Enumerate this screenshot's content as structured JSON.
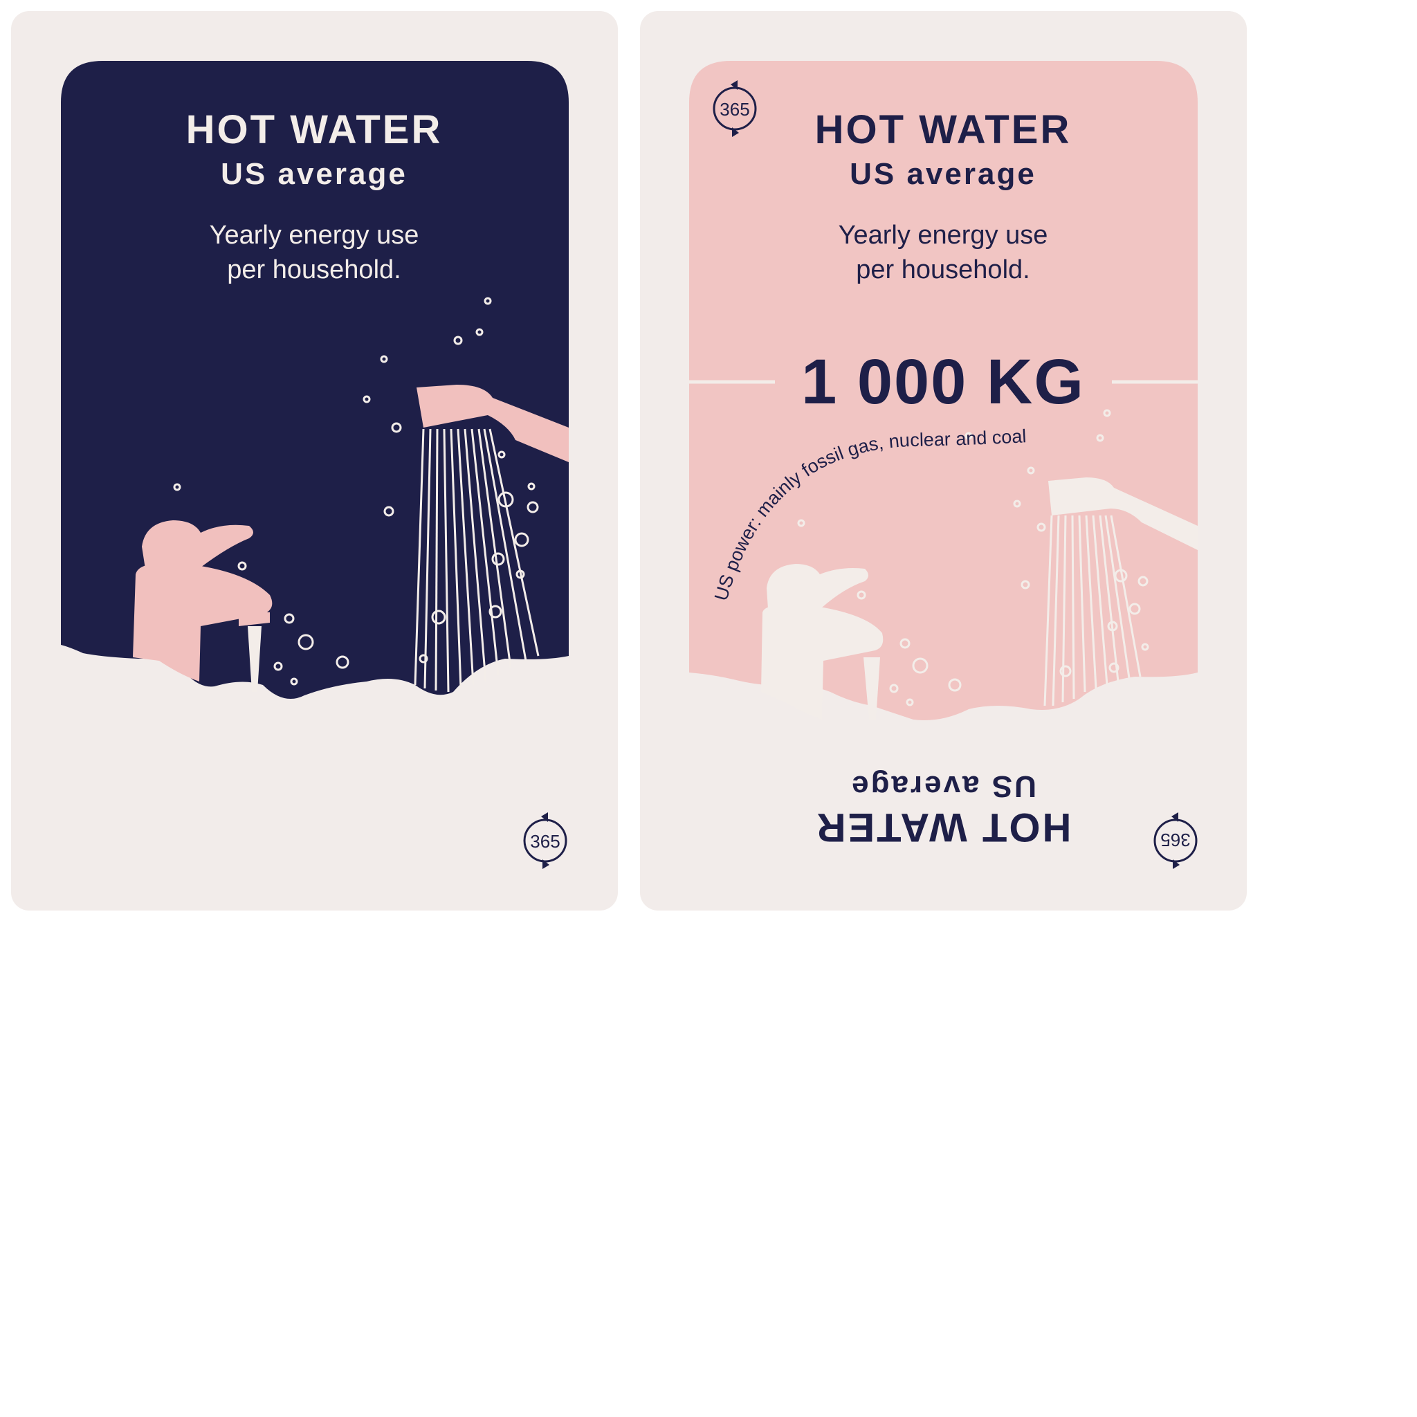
{
  "colors": {
    "card_bg": "#f2ecea",
    "navy": "#1e1f48",
    "pink": "#f1c5c3",
    "light": "#f3ede9",
    "faucet_pink": "#f1c0be"
  },
  "front_card": {
    "title": "HOT WATER",
    "subtitle": "US average",
    "description_line1": "Yearly energy use",
    "description_line2": "per household.",
    "badge": "365",
    "icon": "cycle-365-icon"
  },
  "back_card": {
    "title": "HOT WATER",
    "subtitle": "US average",
    "description_line1": "Yearly energy use",
    "description_line2": "per household.",
    "value": "1 000 KG",
    "source_note": "US power: mainly fossil gas, nuclear and coal",
    "badge_top": "365",
    "badge_bottom": "365",
    "flipped_title": "HOT WATER",
    "flipped_subtitle": "US average"
  }
}
